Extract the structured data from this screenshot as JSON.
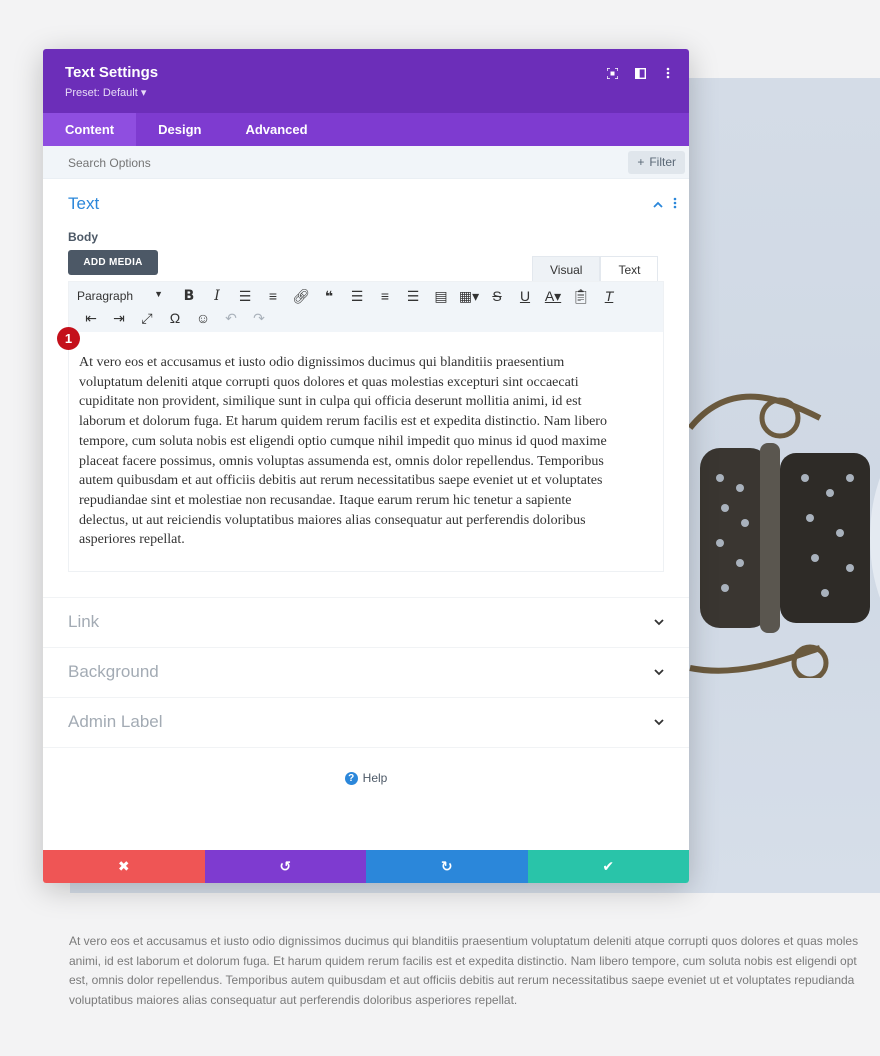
{
  "modal": {
    "title": "Text Settings",
    "preset": "Preset: Default ▾",
    "header_icons": [
      "expand-icon",
      "split-view-icon",
      "more-vertical-icon"
    ],
    "tabs": [
      {
        "label": "Content",
        "active": true
      },
      {
        "label": "Design",
        "active": false
      },
      {
        "label": "Advanced",
        "active": false
      }
    ],
    "search_placeholder": "Search Options",
    "filter_label": "Filter",
    "colors": {
      "header": "#6c2eb9",
      "tabs": "#7e3bd0",
      "accent": "#2b87da"
    }
  },
  "text_section": {
    "title": "Text",
    "body_label": "Body",
    "add_media": "ADD MEDIA",
    "editor_tabs": {
      "visual": "Visual",
      "text": "Text"
    },
    "format_select": "Paragraph",
    "badge": "1",
    "body_lines": [
      "At vero eos et accusamus et iusto odio dignissimos ducimus qui blanditiis praesentium",
      "voluptatum deleniti atque corrupti quos dolores et quas molestias excepturi sint occaecati",
      "cupiditate non provident, similique sunt in culpa qui officia deserunt mollitia animi, id est",
      "laborum et dolorum fuga. Et harum quidem rerum facilis est et expedita distinctio. Nam libero",
      "tempore, cum soluta nobis est eligendi optio cumque nihil impedit quo minus id quod maxime",
      "placeat facere possimus, omnis voluptas assumenda est, omnis dolor repellendus. Temporibus",
      "autem quibusdam et aut officiis debitis aut rerum necessitatibus saepe eveniet ut et voluptates",
      "repudiandae sint et molestiae non recusandae. Itaque earum rerum hic tenetur a sapiente",
      "delectus, ut aut reiciendis voluptatibus maiores alias consequatur aut perferendis doloribus",
      "asperiores repellat."
    ]
  },
  "collapsed_sections": [
    "Link",
    "Background",
    "Admin Label"
  ],
  "help_label": "Help",
  "footer": {
    "buttons": [
      {
        "name": "discard-button",
        "icon": "✖",
        "color": "#ef5555"
      },
      {
        "name": "undo-button",
        "icon": "↺",
        "color": "#7e3bd0"
      },
      {
        "name": "redo-button",
        "icon": "↻",
        "color": "#2b87da"
      },
      {
        "name": "save-button",
        "icon": "✔",
        "color": "#29c4a9"
      }
    ]
  },
  "background_page": {
    "paragraph_lines": [
      "At vero eos et accusamus et iusto odio dignissimos ducimus qui blanditiis praesentium voluptatum deleniti atque corrupti quos dolores et quas moles",
      "animi, id est laborum et dolorum fuga. Et harum quidem rerum facilis est et expedita distinctio. Nam libero tempore, cum soluta nobis est eligendi opt",
      "est, omnis dolor repellendus. Temporibus autem quibusdam et aut officiis debitis aut rerum necessitatibus saepe eveniet ut et voluptates repudianda",
      "voluptatibus maiores alias consequatur aut perferendis doloribus asperiores repellat."
    ]
  }
}
